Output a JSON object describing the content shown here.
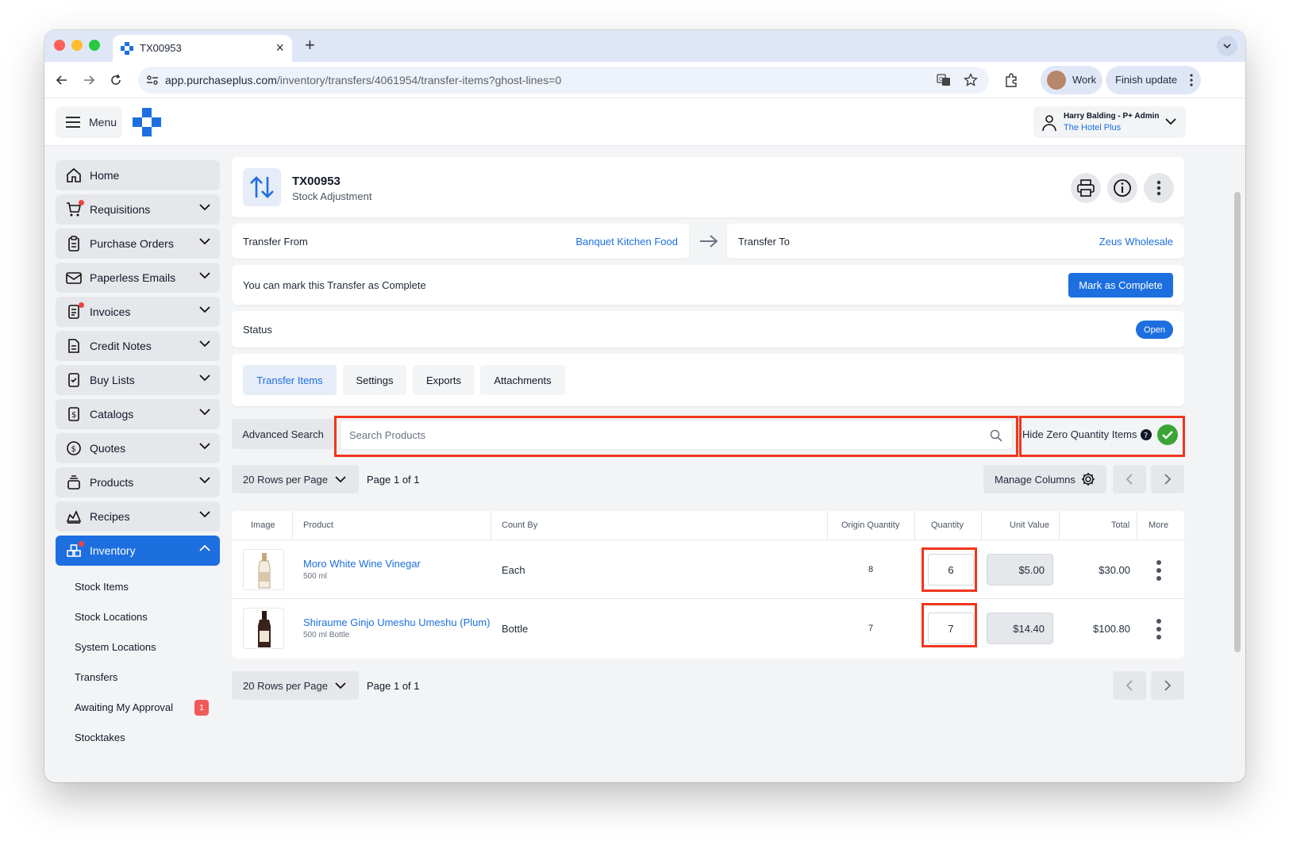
{
  "browser": {
    "tab_title": "TX00953",
    "url_host": "app.purchaseplus.com",
    "url_path": "/inventory/transfers/4061954/transfer-items?ghost-lines=0",
    "profile_label": "Work",
    "finish_update_label": "Finish update"
  },
  "header": {
    "menu_label": "Menu",
    "user_name": "Harry Balding - P+ Admin",
    "user_org": "The Hotel Plus"
  },
  "sidebar": {
    "items": [
      {
        "label": "Home"
      },
      {
        "label": "Requisitions"
      },
      {
        "label": "Purchase Orders"
      },
      {
        "label": "Paperless Emails"
      },
      {
        "label": "Invoices"
      },
      {
        "label": "Credit Notes"
      },
      {
        "label": "Buy Lists"
      },
      {
        "label": "Catalogs"
      },
      {
        "label": "Quotes"
      },
      {
        "label": "Products"
      },
      {
        "label": "Recipes"
      },
      {
        "label": "Inventory"
      }
    ],
    "sub_items": [
      {
        "label": "Stock Items"
      },
      {
        "label": "Stock Locations"
      },
      {
        "label": "System Locations"
      },
      {
        "label": "Transfers"
      },
      {
        "label": "Awaiting My Approval",
        "badge": "1"
      },
      {
        "label": "Stocktakes"
      }
    ]
  },
  "transfer": {
    "id": "TX00953",
    "type": "Stock Adjustment",
    "from_label": "Transfer From",
    "from_value": "Banquet Kitchen Food",
    "to_label": "Transfer To",
    "to_value": "Zeus Wholesale",
    "complete_message": "You can mark this Transfer as Complete",
    "complete_button": "Mark as Complete",
    "status_label": "Status",
    "status_value": "Open"
  },
  "tabs": [
    {
      "label": "Transfer Items"
    },
    {
      "label": "Settings"
    },
    {
      "label": "Exports"
    },
    {
      "label": "Attachments"
    }
  ],
  "search": {
    "advanced_label": "Advanced Search",
    "placeholder": "Search Products",
    "hide_zero_label": "Hide Zero Quantity Items"
  },
  "pagination": {
    "rows_per_page": "20 Rows per Page",
    "page_info": "Page 1 of 1",
    "manage_columns": "Manage Columns"
  },
  "table": {
    "headers": [
      "Image",
      "Product",
      "Count By",
      "Origin Quantity",
      "Quantity",
      "Unit Value",
      "Total",
      "More"
    ],
    "rows": [
      {
        "product": "Moro White Wine Vinegar",
        "size": "500 ml",
        "count_by": "Each",
        "origin_qty": "8",
        "qty": "6",
        "unit_value": "$5.00",
        "total": "$30.00"
      },
      {
        "product": "Shiraume Ginjo Umeshu Umeshu (Plum)",
        "size": "500 ml Bottle",
        "count_by": "Bottle",
        "origin_qty": "7",
        "qty": "7",
        "unit_value": "$14.40",
        "total": "$100.80"
      }
    ]
  },
  "colors": {
    "accent": "#1d6fe0",
    "highlight": "#f0361c",
    "success": "#3aa535",
    "badge": "#f25a5a"
  }
}
